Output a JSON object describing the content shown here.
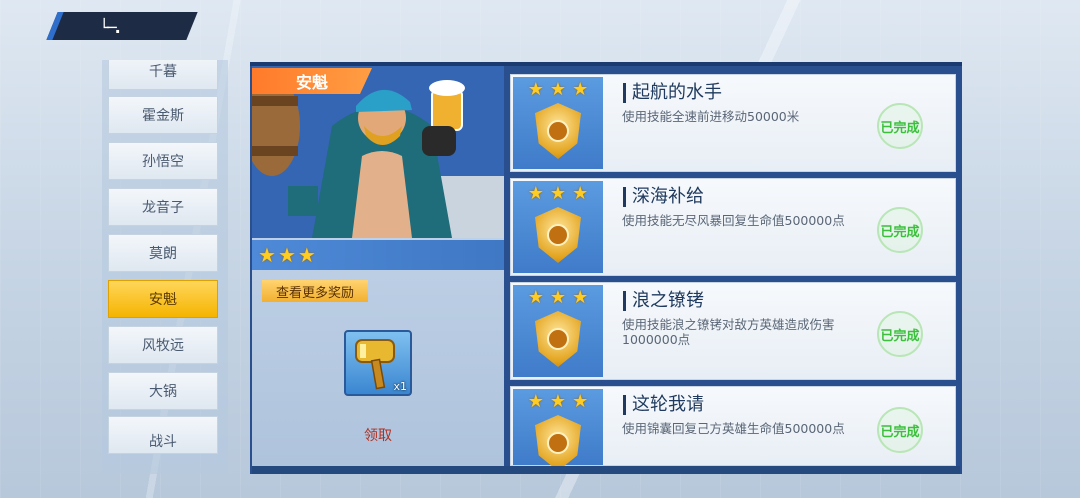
{
  "sidebar": {
    "items": [
      {
        "label": "千暮",
        "active": false
      },
      {
        "label": "霍金斯",
        "active": false
      },
      {
        "label": "孙悟空",
        "active": false
      },
      {
        "label": "龙音子",
        "active": false
      },
      {
        "label": "莫朗",
        "active": false
      },
      {
        "label": "安魁",
        "active": true
      },
      {
        "label": "风牧远",
        "active": false
      },
      {
        "label": "大锅",
        "active": false
      },
      {
        "label": "战斗",
        "active": false
      }
    ]
  },
  "hero": {
    "name": "安魁",
    "stars": 3,
    "more_rewards_label": "查看更多奖励",
    "reward": {
      "icon": "golden-hammer-icon",
      "quantity": "x1"
    },
    "claim_label": "领取"
  },
  "achievements": [
    {
      "title": "起航的水手",
      "desc": "使用技能全速前进移动50000米",
      "status": "已完成",
      "stars": 3
    },
    {
      "title": "深海补给",
      "desc": "使用技能无尽风暴回复生命值500000点",
      "status": "已完成",
      "stars": 3
    },
    {
      "title": "浪之镣铐",
      "desc": "使用技能浪之镣铐对敌方英雄造成伤害1000000点",
      "status": "已完成",
      "stars": 3
    },
    {
      "title": "这轮我请",
      "desc": "使用锦囊回复己方英雄生命值500000点",
      "status": "已完成",
      "stars": 3
    }
  ],
  "colors": {
    "accent_orange": "#ff7a2a",
    "active_tab": "#f5b400",
    "complete_green": "#3cc03c",
    "frame_blue": "#2a4f8e"
  }
}
